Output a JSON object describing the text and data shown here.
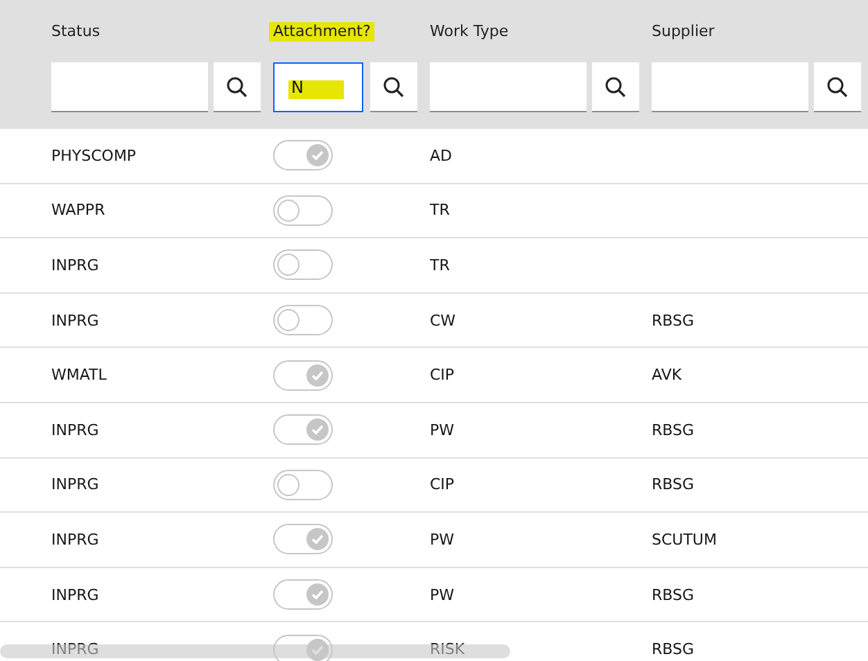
{
  "columns": [
    {
      "label": "Status",
      "highlighted": false,
      "filter": {
        "highlighted": false,
        "focused": false
      }
    },
    {
      "label": "Attachment?",
      "highlighted": true,
      "filter": {
        "value": "N",
        "highlighted": true,
        "focused": true
      }
    },
    {
      "label": "Work Type",
      "highlighted": false,
      "filter": {
        "highlighted": false,
        "focused": false
      }
    },
    {
      "label": "Supplier",
      "highlighted": false,
      "filter": {
        "highlighted": false,
        "focused": false
      }
    }
  ],
  "rows": [
    {
      "status": "PHYSCOMP",
      "attachment": true,
      "work_type": "AD"
    },
    {
      "status": "WAPPR",
      "attachment": false,
      "work_type": "TR"
    },
    {
      "status": "INPRG",
      "attachment": false,
      "work_type": "TR"
    },
    {
      "status": "INPRG",
      "attachment": false,
      "work_type": "CW",
      "supplier": "RBSG"
    },
    {
      "status": "WMATL",
      "attachment": true,
      "work_type": "CIP",
      "supplier": "AVK"
    },
    {
      "status": "INPRG",
      "attachment": true,
      "work_type": "PW",
      "supplier": "RBSG"
    },
    {
      "status": "INPRG",
      "attachment": false,
      "work_type": "CIP",
      "supplier": "RBSG"
    },
    {
      "status": "INPRG",
      "attachment": true,
      "work_type": "PW",
      "supplier": "SCUTUM"
    },
    {
      "status": "INPRG",
      "attachment": true,
      "work_type": "PW",
      "supplier": "RBSG"
    },
    {
      "status": "INPRG",
      "attachment": true,
      "work_type": "RISK",
      "supplier": "RBSG"
    }
  ]
}
